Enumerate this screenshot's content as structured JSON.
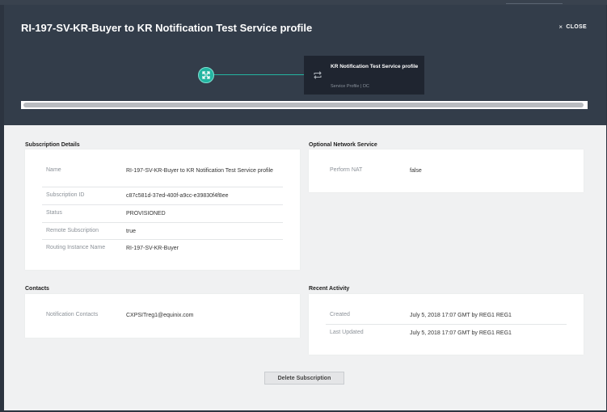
{
  "header": {
    "title": "RI-197-SV-KR-Buyer to KR Notification Test Service profile",
    "close_label": "CLOSE",
    "close_icon": "×"
  },
  "topology": {
    "service_name": "KR Notification Test Service profile",
    "service_type": "Service Profile | DC",
    "node_icon": "route-icon",
    "service_icon": "repeat-icon",
    "accent_color": "#23b5a1"
  },
  "subscription_details": {
    "title": "Subscription Details",
    "rows": [
      {
        "label": "Name",
        "value": "RI-197-SV-KR-Buyer to KR Notification Test Service profile"
      },
      {
        "label": "Subscription ID",
        "value": "c87c581d-37ed-400f-a9cc-e39830f4f8ee"
      },
      {
        "label": "Status",
        "value": "PROVISIONED"
      },
      {
        "label": "Remote Subscription",
        "value": "true"
      },
      {
        "label": "Routing Instance Name",
        "value": "RI-197-SV-KR-Buyer"
      }
    ]
  },
  "optional_network_service": {
    "title": "Optional Network Service",
    "rows": [
      {
        "label": "Perform NAT",
        "value": "false"
      }
    ]
  },
  "contacts": {
    "title": "Contacts",
    "rows": [
      {
        "label": "Notification Contacts",
        "value": "CXPSITreg1@equinix.com"
      }
    ]
  },
  "recent_activity": {
    "title": "Recent Activity",
    "rows": [
      {
        "label": "Created",
        "value": "July 5, 2018 17:07 GMT by REG1 REG1"
      },
      {
        "label": "Last Updated",
        "value": "July 5, 2018 17:07 GMT by REG1 REG1"
      }
    ]
  },
  "actions": {
    "delete_label": "Delete Subscription"
  }
}
